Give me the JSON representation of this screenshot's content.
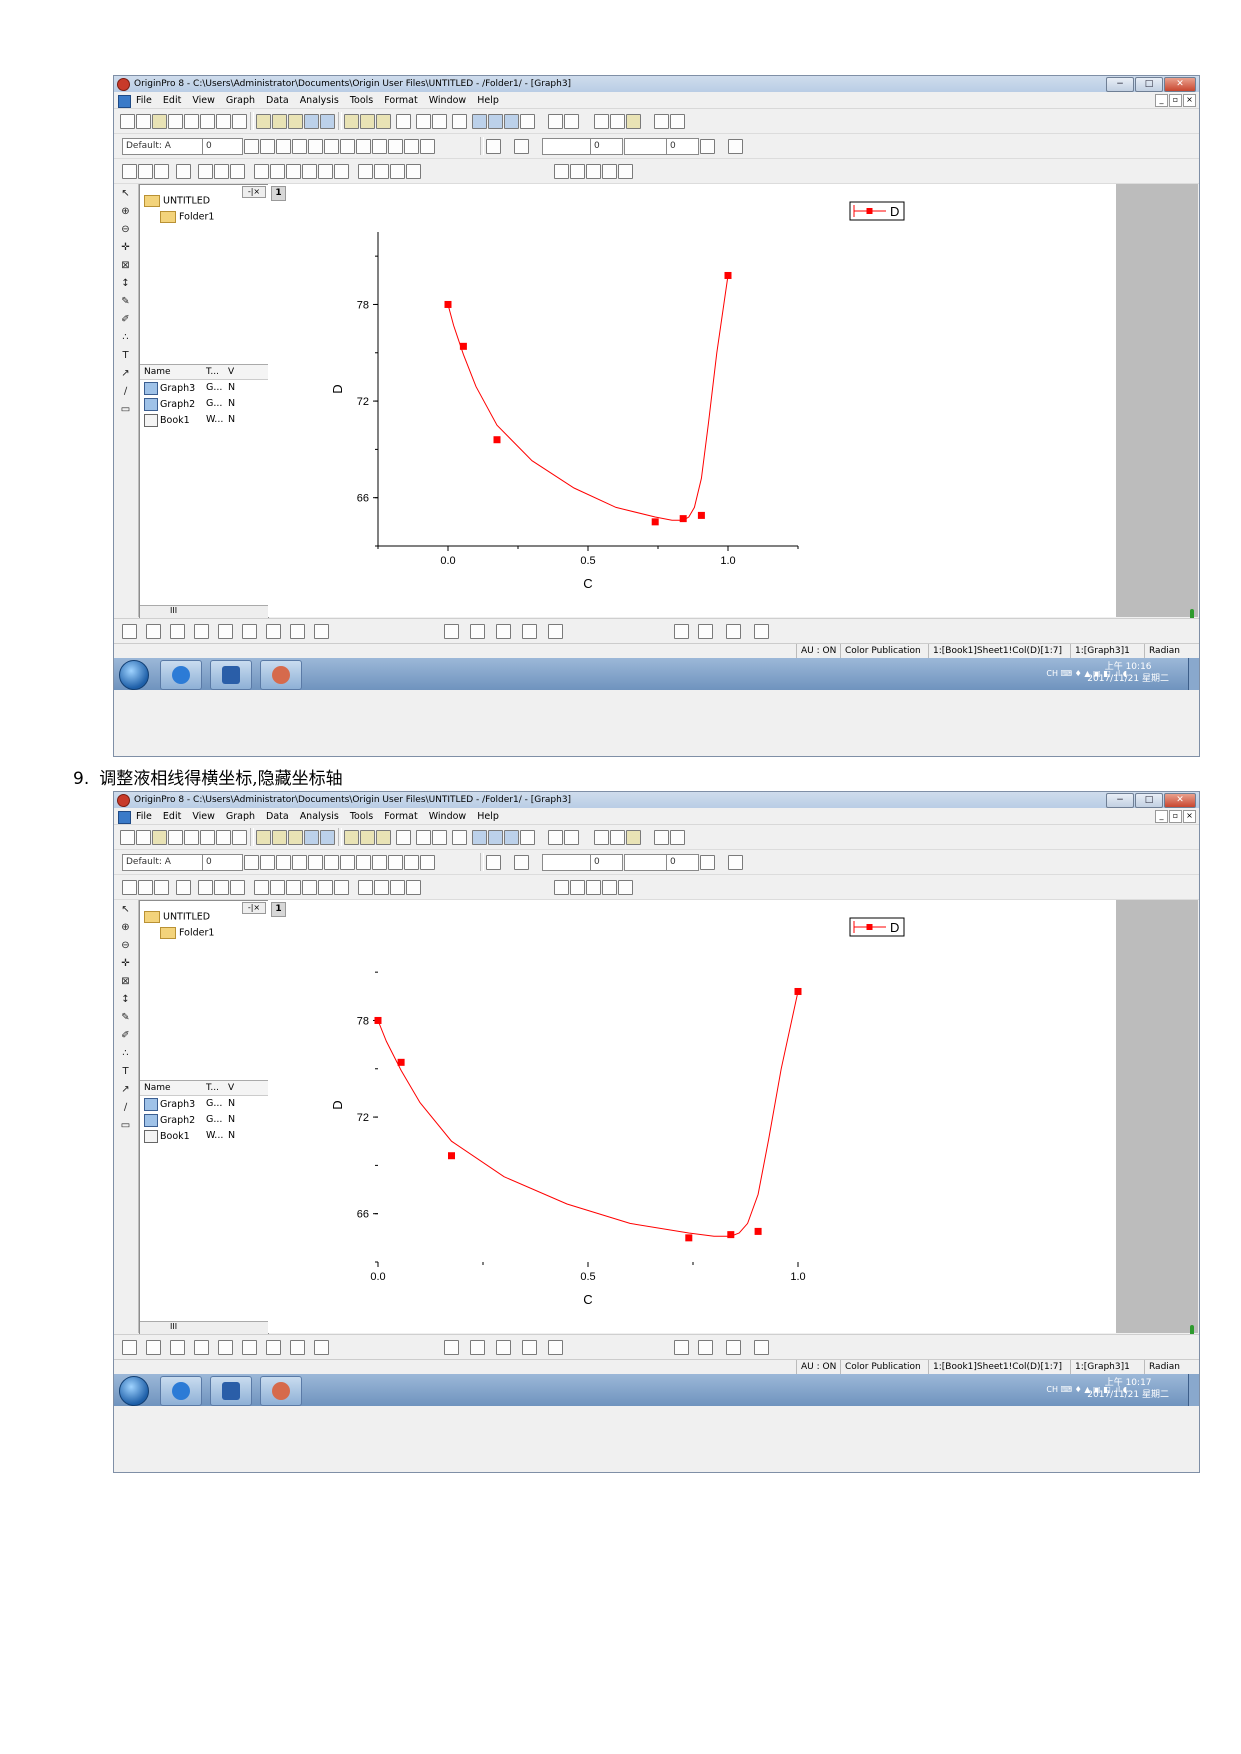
{
  "caption": {
    "number": "9.",
    "text": "调整液相线得横坐标,隐藏坐标轴"
  },
  "window": {
    "title": "OriginPro 8 - C:\\Users\\Administrator\\Documents\\Origin User Files\\UNTITLED - /Folder1/ - [Graph3]",
    "menu": [
      "File",
      "Edit",
      "View",
      "Graph",
      "Data",
      "Analysis",
      "Tools",
      "Format",
      "Window",
      "Help"
    ],
    "format_toolbar": {
      "font_name": "Default: A",
      "font_size": "0",
      "line_width": "0",
      "border_width": "0"
    },
    "window_buttons": {
      "minimize": "−",
      "maximize": "□",
      "close": "✕"
    },
    "mdi_buttons": [
      "_",
      "▫",
      "×"
    ]
  },
  "explorer": {
    "root": "UNTITLED",
    "folder": "Folder1",
    "columns": [
      "Name",
      "T...",
      "V"
    ],
    "items": [
      {
        "name": "Graph3",
        "type": "G...",
        "v": "N"
      },
      {
        "name": "Graph2",
        "type": "G...",
        "v": "N"
      },
      {
        "name": "Book1",
        "type": "W...",
        "v": "N"
      }
    ],
    "scroll_label": "III"
  },
  "graph": {
    "layer_tag": "1",
    "legend_label": "D",
    "xlabel": "C",
    "ylabel": "D",
    "marker_color": "#ff0000",
    "line_color": "#ff0000"
  },
  "status": {
    "au": "AU : ON",
    "color_mode": "Color Publication",
    "data_ref": "1:[Book1]Sheet1!Col(D)[1:7]",
    "layer_ref": "1:[Graph3]1",
    "angle": "Radian"
  },
  "screenshots": [
    {
      "clock_time": "上午 10:16",
      "clock_date": "2017/11/21 星期二"
    },
    {
      "clock_time": "上午 10:17",
      "clock_date": "2017/11/21 星期二"
    }
  ],
  "tray": {
    "ime": "CH"
  },
  "chart_data": [
    {
      "type": "scatter",
      "title": "",
      "xlabel": "C",
      "ylabel": "D",
      "legend": [
        "D"
      ],
      "legend_position": "top-right",
      "xlim": [
        -0.25,
        1.25
      ],
      "ylim": [
        63.0,
        82.5
      ],
      "xticks": [
        "0.0",
        "0.5",
        "1.0"
      ],
      "yticks": [
        "66",
        "72",
        "78"
      ],
      "axes_visible": true,
      "series": [
        {
          "name": "D",
          "x": [
            0.0,
            0.055,
            0.175,
            0.74,
            0.84,
            0.905,
            1.0
          ],
          "y": [
            78.0,
            75.4,
            69.6,
            64.5,
            64.7,
            64.9,
            79.8
          ]
        }
      ],
      "curve": {
        "x": [
          0.0,
          0.02,
          0.055,
          0.1,
          0.175,
          0.3,
          0.45,
          0.6,
          0.74,
          0.8,
          0.84,
          0.86,
          0.88,
          0.905,
          0.93,
          0.96,
          1.0
        ],
        "y": [
          78.0,
          76.7,
          74.9,
          72.9,
          70.5,
          68.3,
          66.6,
          65.4,
          64.8,
          64.6,
          64.6,
          64.8,
          65.4,
          67.2,
          70.6,
          75.0,
          79.8
        ]
      }
    },
    {
      "type": "scatter",
      "title": "",
      "xlabel": "C",
      "ylabel": "D",
      "legend": [
        "D"
      ],
      "legend_position": "top-right",
      "xlim": [
        0.0,
        1.0
      ],
      "ylim": [
        63.0,
        82.5
      ],
      "xticks": [
        "0.0",
        "0.5",
        "1.0"
      ],
      "yticks": [
        "66",
        "72",
        "78"
      ],
      "axes_visible": false,
      "series": [
        {
          "name": "D",
          "x": [
            0.0,
            0.055,
            0.175,
            0.74,
            0.84,
            0.905,
            1.0
          ],
          "y": [
            78.0,
            75.4,
            69.6,
            64.5,
            64.7,
            64.9,
            79.8
          ]
        }
      ],
      "curve": {
        "x": [
          0.0,
          0.02,
          0.055,
          0.1,
          0.175,
          0.3,
          0.45,
          0.6,
          0.74,
          0.8,
          0.84,
          0.86,
          0.88,
          0.905,
          0.93,
          0.96,
          1.0
        ],
        "y": [
          78.0,
          76.7,
          74.9,
          72.9,
          70.5,
          68.3,
          66.6,
          65.4,
          64.8,
          64.6,
          64.6,
          64.8,
          65.4,
          67.2,
          70.6,
          75.0,
          79.8
        ]
      }
    }
  ]
}
